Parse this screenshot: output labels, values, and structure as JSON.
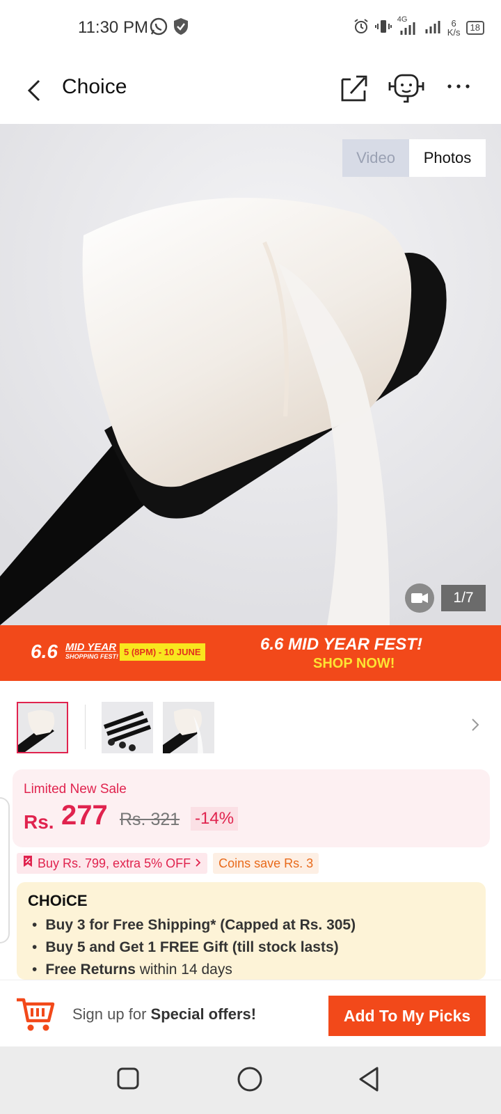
{
  "status_bar": {
    "time": "11:30 PM",
    "network": "4G",
    "speed_value": "6",
    "speed_unit": "K/s",
    "battery": "18"
  },
  "header": {
    "title": "Choice"
  },
  "gallery": {
    "toggle_video": "Video",
    "toggle_photos": "Photos",
    "counter": "1/7"
  },
  "banner": {
    "num": "6.6",
    "mid_year": "MID YEAR",
    "shopping_fest": "SHOPPING FEST!",
    "dates": "5 (8PM) - 10 JUNE",
    "title": "6.6 MID YEAR FEST!",
    "cta": "SHOP NOW!"
  },
  "price": {
    "label": "Limited New Sale",
    "currency": "Rs.",
    "amount": "277",
    "old_price": "Rs. 321",
    "discount": "-14%"
  },
  "promos": {
    "extra_off": "Buy Rs. 799, extra 5% OFF",
    "coins": "Coins save Rs. 3"
  },
  "choice": {
    "logo": "CHOiCE",
    "items": [
      {
        "bold": "Buy 3 for  Free Shipping* (Capped at Rs. 305)",
        "rest": ""
      },
      {
        "bold": "Buy 5 and Get 1 FREE Gift (till stock lasts)",
        "rest": ""
      },
      {
        "bold": "Free Returns",
        "rest": " within 14 days"
      }
    ]
  },
  "action_bar": {
    "signup_prefix": "Sign up for ",
    "signup_bold": "Special offers!",
    "add_button": "Add To My Picks"
  },
  "colors": {
    "brand_orange": "#f2491a",
    "price_red": "#e0234e",
    "choice_bg": "#fdf3d7"
  }
}
